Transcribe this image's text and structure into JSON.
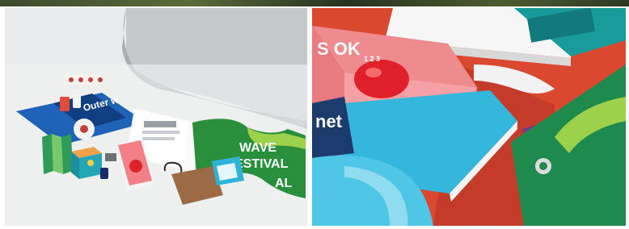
{
  "scene": {
    "left_photo": {
      "poster_text": "Outer w",
      "banner_text_lines": [
        "WAVE",
        "ESTIVAL"
      ],
      "banner_letters": [
        "AL"
      ]
    },
    "right_photo": {
      "book_text": "S OK",
      "cover_small_text": "1 2 3",
      "sign_text": "net"
    }
  },
  "colors": {
    "backdrop_grey": "#c9ccce",
    "floor": "#eef0f1",
    "poster_blue": "#1e63b8",
    "banner_green": "#2a8f3c",
    "book_pink": "#f27f86",
    "tomato_red": "#e0202a",
    "cyan": "#30b3d8",
    "background_red": "#d9482f",
    "purple": "#7a3a8c",
    "card_green": "#1f8a4e",
    "lime": "#9ed14b"
  }
}
